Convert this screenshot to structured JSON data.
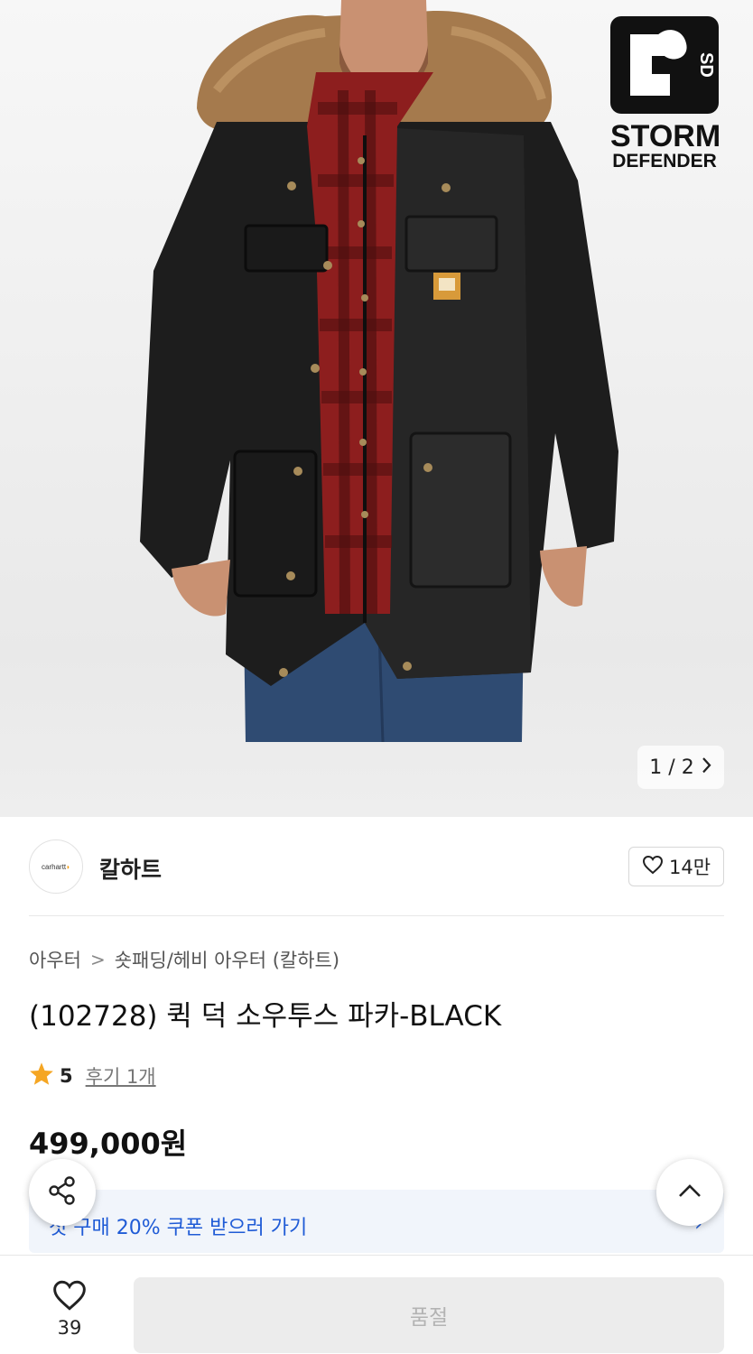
{
  "product_image": {
    "alt": "Black parka with fur-trimmed hood worn over red plaid shirt",
    "badge_line1": "STORM",
    "badge_line2": "DEFENDER",
    "counter": "1 / 2",
    "counter_next_icon": "chevron-right-icon"
  },
  "brand": {
    "logo_text": "carhartt",
    "name": "칼하트",
    "like_count": "14만",
    "like_icon": "heart-outline-icon"
  },
  "breadcrumb": {
    "level1": "아우터",
    "separator": ">",
    "level2": "숏패딩/헤비 아우터 (칼하트)"
  },
  "product": {
    "title": "(102728) 퀵 덕 소우투스 파카-BLACK",
    "rating": "5",
    "reviews_link": "후기 1개",
    "price": "499,000원"
  },
  "coupon": {
    "text": "첫 구매 20% 쿠폰 받으러 가기",
    "chevron": "›"
  },
  "bottom_bar": {
    "wish_count": "39",
    "buy_button": "품절"
  },
  "colors": {
    "accent_blue": "#1f5bd6",
    "star": "#f5a623",
    "coupon_bg": "#f1f5fb"
  }
}
